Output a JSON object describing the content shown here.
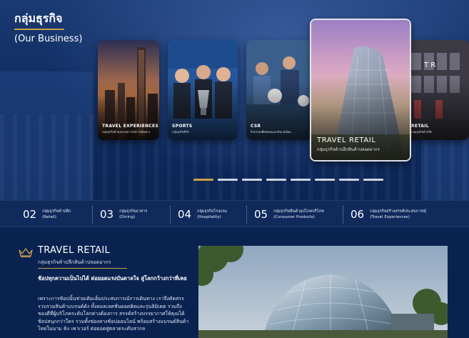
{
  "hero": {
    "title": "กลุ่มธุรกิจ",
    "subtitle": "(Our Business)",
    "cards": [
      {
        "label": "TRAVEL EXPERIENCES",
        "sublabel": "กลุ่มธุรกิจด้านประสบการณ์การเดินทาง"
      },
      {
        "label": "SPORTS",
        "sublabel": "กลุ่มธุรกิจกีฬา"
      },
      {
        "label": "CSR",
        "sublabel": "กิจกรรมเพื่อสังคมและสิ่งแวดล้อม"
      },
      {
        "label": "TRAVEL RETAIL",
        "sublabel": "กลุ่มธุรกิจค้าปลีกสินค้าปลอดอากร"
      },
      {
        "label": "RETAIL",
        "sublabel": "กลุ่มธุรกิจค้าปลีก"
      }
    ],
    "slide_count": 8,
    "active_slide": 0,
    "accent_color": "#c9a04a"
  },
  "tabs": [
    {
      "num": "02",
      "th": "กลุ่มธุรกิจค้าปลีก",
      "en": "(Retail)"
    },
    {
      "num": "03",
      "th": "กลุ่มธุรกิจอาหาร",
      "en": "(Dining)"
    },
    {
      "num": "04",
      "th": "กลุ่มธุรกิจโรงแรม",
      "en": "(Hospitality)"
    },
    {
      "num": "05",
      "th": "กลุ่มธุรกิจสินค้าอุปโภคบริโภค",
      "en": "(Consumer Products)"
    },
    {
      "num": "06",
      "th": "กลุ่มธุรกิจสร้างสรรค์ประสบการณ์",
      "en": "(Travel Experiences)"
    }
  ],
  "section": {
    "icon": "crown-icon",
    "title": "TRAVEL RETAIL",
    "subtitle": "กลุ่มธุรกิจค้าปลีกสินค้าปลอดอากร",
    "lead": "ช้อปทุกความเป็นไปได้ ต่อยอดแรงบันดาลใจ สู่โลกกว้างกว่าที่เคย",
    "body": "เพราะการช้อปนั้นช่วยเติมเต็มประสบการณ์การเดินทาง เราจึงคัดสรรรวบรวมสินค้าแบรนด์ดัง ทั้งคอลเลคชั่นยอดฮิตและรุ่นลิมิเตด รวมถึงของดีที่ผู้บริโภคระดับโลกต่างต้องการ สรรค์สร้างบรรยากาศให้คุณได้ช้อปสนุกกว่าใคร รวมทั้งช่องทางช้อปออนไลน์ พร้อมสร้างแบรนด์สินค้าไทยในนาม คิง เพาเวอร์ ต่อยอดสู่ตลาดระดับสากล"
  }
}
